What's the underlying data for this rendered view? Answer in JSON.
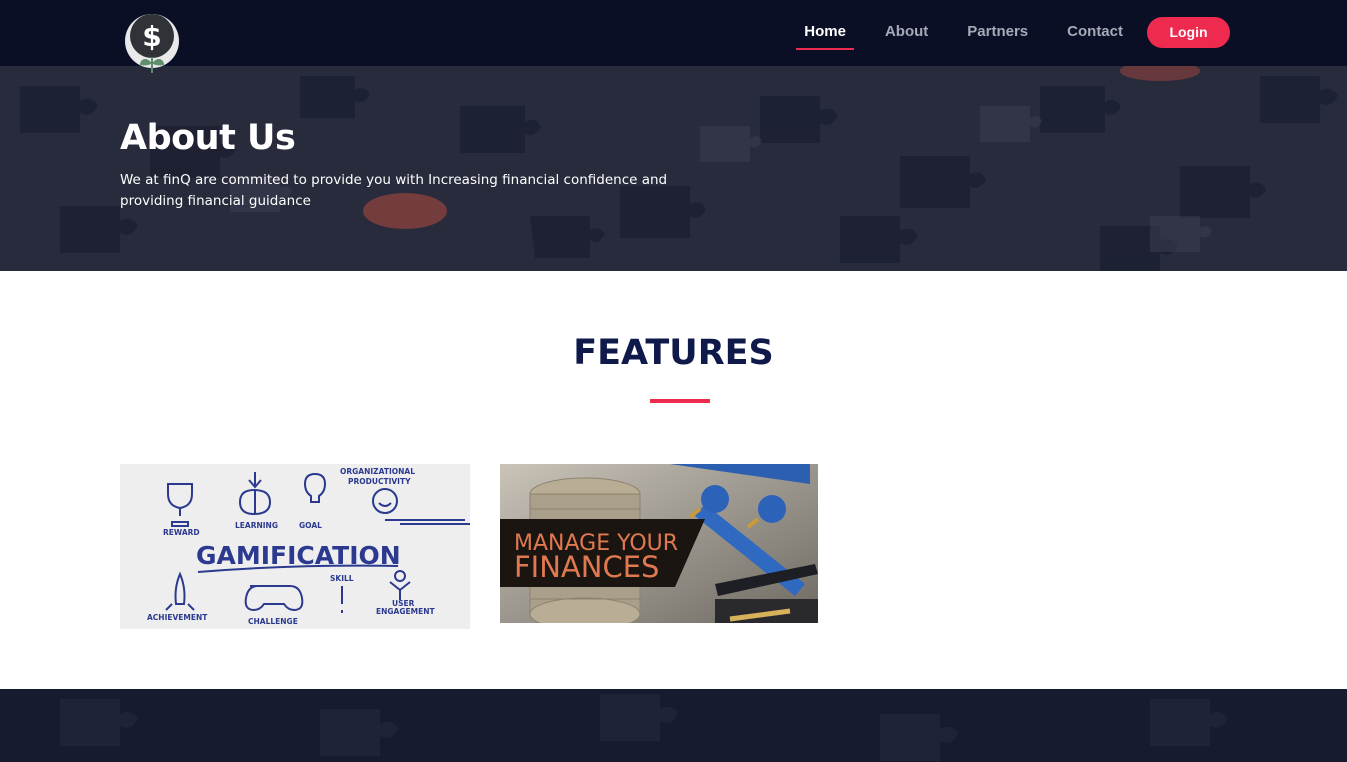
{
  "nav": {
    "items": [
      {
        "label": "Home",
        "active": true
      },
      {
        "label": "About",
        "active": false
      },
      {
        "label": "Partners",
        "active": false
      },
      {
        "label": "Contact",
        "active": false
      }
    ],
    "login_label": "Login"
  },
  "hero": {
    "title": "About Us",
    "text": "We at finQ are commited to provide you with Increasing financial confidence and providing financial guidance"
  },
  "features": {
    "title": "FEATURES",
    "gamification": {
      "title": "GAMIFICATION",
      "labels": {
        "reward": "REWARD",
        "learning": "LEARNING",
        "goal": "GOAL",
        "org_line1": "ORGANIZATIONAL",
        "org_line2": "PRODUCTIVITY",
        "achievement": "ACHIEVEMENT",
        "challenge": "CHALLENGE",
        "skill": "SKILL",
        "user_line1": "USER",
        "user_line2": "ENGAGEMENT"
      }
    },
    "finances": {
      "line1": "MANAGE YOUR",
      "line2": "FINANCES"
    }
  },
  "colors": {
    "navbar": "#0b0f26",
    "accent": "#ef2a4f",
    "heading": "#0f1a4a",
    "sketch": "#2b3a8f"
  }
}
